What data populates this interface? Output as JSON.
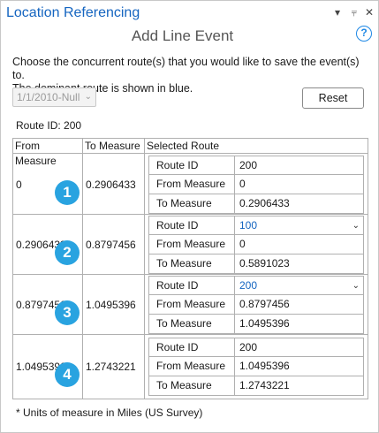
{
  "app": {
    "title": "Location Referencing",
    "subtitle": "Add Line Event",
    "help_icon": "?",
    "menu_icon": "▾",
    "pin_icon": "⫧",
    "close_icon": "✕"
  },
  "instructions": {
    "line1": "Choose the concurrent route(s) that you would like to save the event(s) to.",
    "line2": "The dominant route is shown in blue."
  },
  "date_select": {
    "value": "1/1/2010-Null",
    "chevron": "⌄"
  },
  "reset_label": "Reset",
  "route_id_label": "Route ID: 200",
  "grid": {
    "headers": {
      "from": "From Measure",
      "to": "To Measure",
      "selected": "Selected Route"
    },
    "sub_labels": {
      "route_id": "Route ID",
      "from_measure": "From Measure",
      "to_measure": "To Measure"
    },
    "rows": [
      {
        "badge": "1",
        "from": "0",
        "to": "0.2906433",
        "route_id": "200",
        "dropdown": false,
        "sub_from": "0",
        "sub_to": "0.2906433"
      },
      {
        "badge": "2",
        "from": "0.2906433",
        "to": "0.8797456",
        "route_id": "100",
        "dropdown": true,
        "sub_from": "0",
        "sub_to": "0.5891023"
      },
      {
        "badge": "3",
        "from": "0.8797456",
        "to": "1.0495396",
        "route_id": "200",
        "dropdown": true,
        "sub_from": "0.8797456",
        "sub_to": "1.0495396"
      },
      {
        "badge": "4",
        "from": "1.0495396",
        "to": "1.2743221",
        "route_id": "200",
        "dropdown": false,
        "sub_from": "1.0495396",
        "sub_to": "1.2743221"
      }
    ]
  },
  "footnote": "* Units of measure in Miles (US Survey)"
}
